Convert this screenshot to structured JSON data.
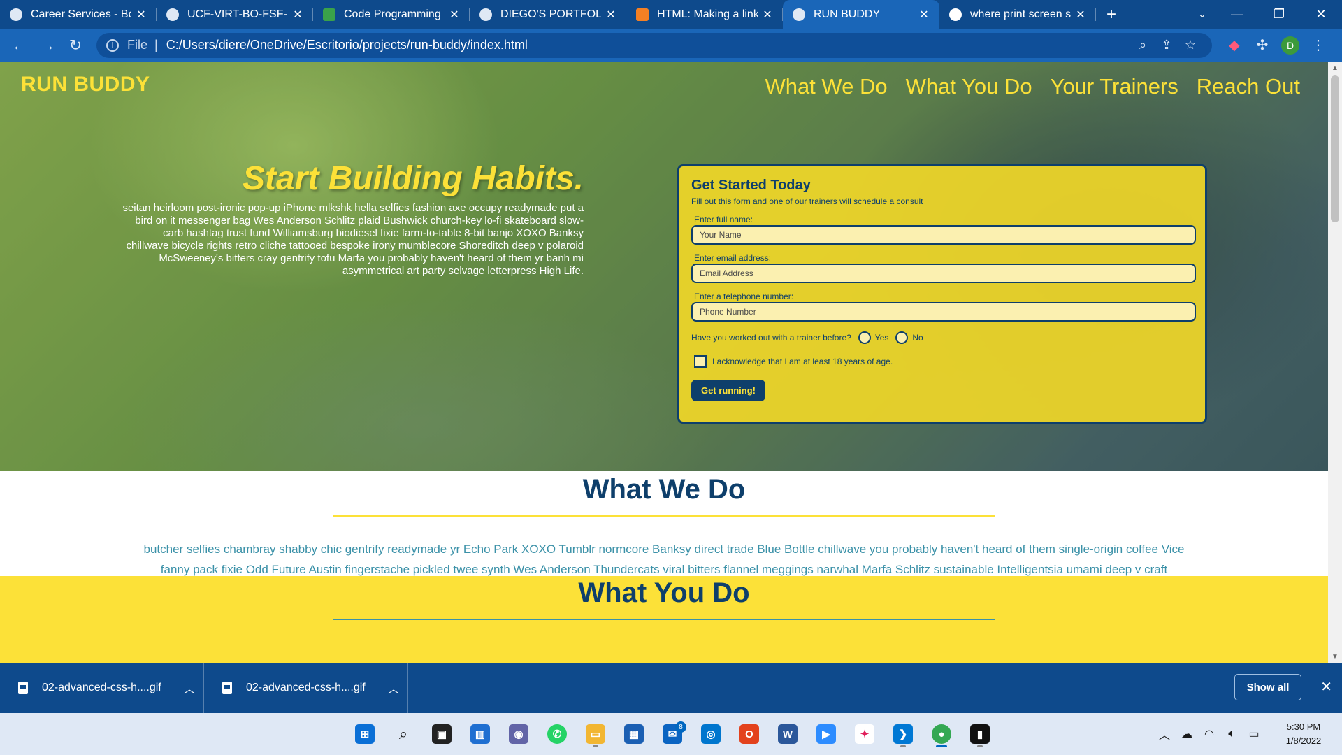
{
  "browser": {
    "tabs": [
      {
        "title": "Career Services - Boot",
        "favicon": "bootcamp-icon"
      },
      {
        "title": "UCF-VIRT-BO-FSF-PT-",
        "favicon": "github-icon"
      },
      {
        "title": "Code Programming H",
        "favicon": "px-icon"
      },
      {
        "title": "DIEGO'S PORTFOLIO",
        "favicon": "globe-icon"
      },
      {
        "title": "HTML: Making a link l",
        "favicon": "stackoverflow-icon"
      },
      {
        "title": "RUN BUDDY",
        "favicon": "globe-icon",
        "active": true
      },
      {
        "title": "where print screen sa",
        "favicon": "google-icon"
      }
    ],
    "address": {
      "scheme": "File",
      "url": "C:/Users/diere/OneDrive/Escritorio/projects/run-buddy/index.html"
    },
    "profile_initial": "D"
  },
  "page": {
    "brand": "RUN BUDDY",
    "nav": [
      "What We Do",
      "What You Do",
      "Your Trainers",
      "Reach Out"
    ],
    "hero": {
      "title": "Start Building Habits.",
      "body": "seitan heirloom post-ironic pop-up iPhone mlkshk hella selfies fashion axe occupy readymade put a bird on it messenger bag Wes Anderson Schlitz plaid Bushwick church-key lo-fi skateboard slow-carb hashtag trust fund Williamsburg biodiesel fixie farm-to-table 8-bit banjo XOXO Banksy chillwave bicycle rights retro cliche tattooed bespoke irony mumblecore Shoreditch deep v polaroid McSweeney's bitters cray gentrify tofu Marfa you probably haven't heard of them yr banh mi asymmetrical art party selvage letterpress High Life."
    },
    "form": {
      "title": "Get Started Today",
      "subtitle": "Fill out this form and one of our trainers will schedule a consult",
      "name_label": "Enter full name:",
      "name_placeholder": "Your Name",
      "email_label": "Enter email address:",
      "email_placeholder": "Email Address",
      "phone_label": "Enter a telephone number:",
      "phone_placeholder": "Phone Number",
      "question": "Have you worked out with a trainer before?",
      "yes": "Yes",
      "no": "No",
      "acknowledge": "I acknowledge that I am at least 18 years of age.",
      "submit": "Get running!"
    },
    "what_we_do": {
      "heading": "What We Do",
      "body": "butcher selfies chambray shabby chic gentrify readymade yr Echo Park XOXO Tumblr normcore Banksy direct trade Blue Bottle chillwave you probably haven't heard of them single-origin coffee Vice fanny pack fixie Odd Future Austin fingerstache pickled twee synth Wes Anderson Thundercats viral bitters flannel meggings narwhal Marfa Schlitz sustainable Intelligentsia umami deep v craft"
    },
    "what_you_do": {
      "heading": "What You Do"
    }
  },
  "downloads": {
    "items": [
      "02-advanced-css-h....gif",
      "02-advanced-css-h....gif"
    ],
    "show_all": "Show all"
  },
  "taskbar": {
    "mail_badge": "8",
    "time": "5:30 PM",
    "date": "1/8/2022"
  },
  "colors": {
    "brand_yellow": "#fce138",
    "brand_navy": "#0e3f6b",
    "teal": "#3b91a8",
    "chrome_blue": "#1a66b8"
  }
}
